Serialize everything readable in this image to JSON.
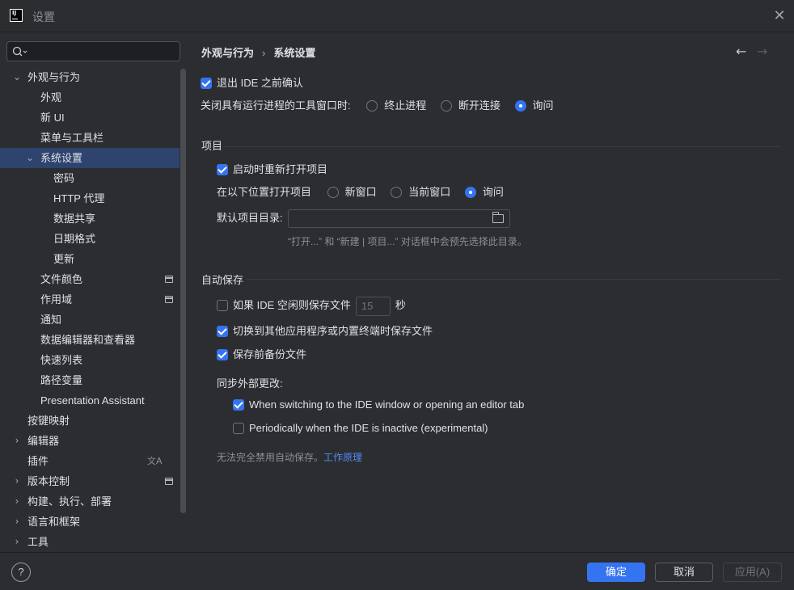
{
  "window": {
    "title": "设置",
    "logo_text": "IJ"
  },
  "sidebar": {
    "search_placeholder": "",
    "items": [
      {
        "label": "外观与行为",
        "level": 0,
        "expanded": true,
        "chevron": "⌄"
      },
      {
        "label": "外观",
        "level": 1
      },
      {
        "label": "新 UI",
        "level": 1
      },
      {
        "label": "菜单与工具栏",
        "level": 1
      },
      {
        "label": "系统设置",
        "level": 1,
        "expanded": true,
        "selected": true,
        "chevron": "⌄"
      },
      {
        "label": "密码",
        "level": 2
      },
      {
        "label": "HTTP 代理",
        "level": 2
      },
      {
        "label": "数据共享",
        "level": 2
      },
      {
        "label": "日期格式",
        "level": 2
      },
      {
        "label": "更新",
        "level": 2
      },
      {
        "label": "文件颜色",
        "level": 1,
        "icon": "project-icon"
      },
      {
        "label": "作用域",
        "level": 1,
        "icon": "project-icon"
      },
      {
        "label": "通知",
        "level": 1
      },
      {
        "label": "数据编辑器和查看器",
        "level": 1
      },
      {
        "label": "快速列表",
        "level": 1
      },
      {
        "label": "路径变量",
        "level": 1
      },
      {
        "label": "Presentation Assistant",
        "level": 1
      },
      {
        "label": "按键映射",
        "level": 0
      },
      {
        "label": "编辑器",
        "level": 0,
        "chevron": "›"
      },
      {
        "label": "插件",
        "level": 0,
        "icon": "translate-icon"
      },
      {
        "label": "版本控制",
        "level": 0,
        "chevron": "›",
        "icon": "project-icon"
      },
      {
        "label": "构建、执行、部署",
        "level": 0,
        "chevron": "›"
      },
      {
        "label": "语言和框架",
        "level": 0,
        "chevron": "›"
      },
      {
        "label": "工具",
        "level": 0,
        "chevron": "›"
      }
    ]
  },
  "header": {
    "breadcrumb": [
      "外观与行为",
      "系统设置"
    ],
    "separator": "›",
    "back_icon": "←",
    "forward_icon": "→"
  },
  "general": {
    "confirm_exit": {
      "label": "退出 IDE 之前确认",
      "checked": true
    },
    "close_tool_window": {
      "label": "关闭具有运行进程的工具窗口时:",
      "options": [
        "终止进程",
        "断开连接",
        "询问"
      ],
      "selected": "询问"
    }
  },
  "project": {
    "title": "项目",
    "reopen": {
      "label": "启动时重新打开项目",
      "checked": true
    },
    "open_in": {
      "label": "在以下位置打开项目",
      "options": [
        "新窗口",
        "当前窗口",
        "询问"
      ],
      "selected": "询问"
    },
    "default_dir": {
      "label": "默认项目目录:",
      "value": ""
    },
    "default_dir_hint": "“打开...” 和 “新建 | 项目...” 对话框中会预先选择此目录。"
  },
  "autosave": {
    "title": "自动保存",
    "idle_save": {
      "label_before": "如果 IDE 空闲则保存文件",
      "value": "15",
      "unit": "秒",
      "checked": false
    },
    "switch_save": {
      "label": "切换到其他应用程序或内置终端时保存文件",
      "checked": true
    },
    "backup": {
      "label": "保存前备份文件",
      "checked": true
    },
    "sync_label": "同步外部更改:",
    "sync_on_switch": {
      "label": "When switching to the IDE window or opening an editor tab",
      "checked": true
    },
    "sync_periodic": {
      "label": "Periodically when the IDE is inactive (experimental)",
      "checked": false
    },
    "note": "无法完全禁用自动保存。",
    "note_link": "工作原理"
  },
  "footer": {
    "help": "?",
    "ok": "确定",
    "cancel": "取消",
    "apply": "应用(A)"
  },
  "colors": {
    "accent": "#3574f0",
    "selection": "#2e436e",
    "background": "#2b2d30",
    "link": "#548af7"
  }
}
